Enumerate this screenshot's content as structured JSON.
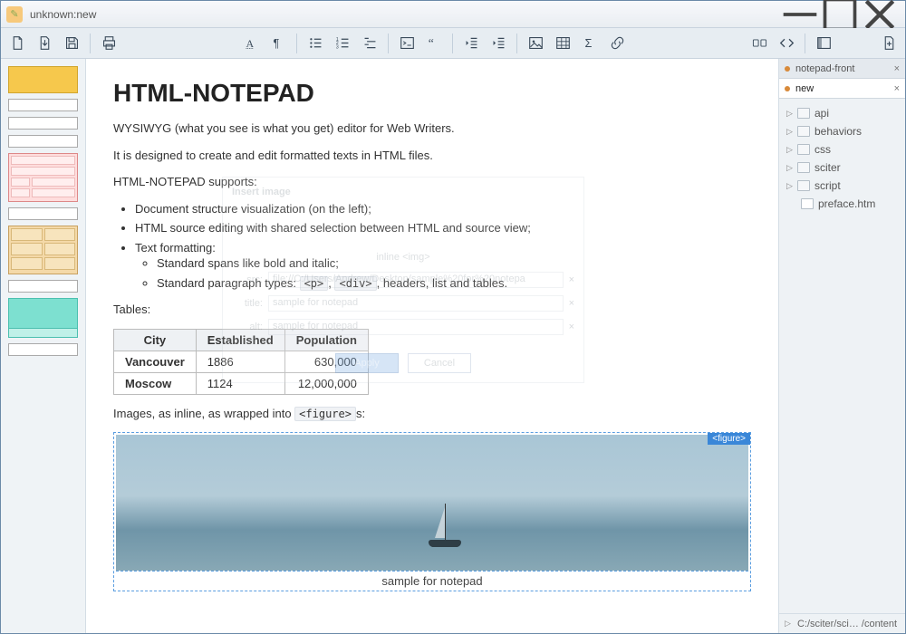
{
  "window": {
    "title": "unknown:new"
  },
  "toolbar": {
    "new": "New",
    "open": "Open",
    "save": "Save",
    "print": "Print",
    "font": "Font",
    "para": "Paragraph",
    "ul": "Unordered list",
    "ol": "Ordered list",
    "dl": "Definition list",
    "pre": "Preformatted",
    "quote": "Blockquote",
    "outdent": "Outdent",
    "indent": "Indent",
    "image": "Image",
    "table": "Table",
    "formula": "Formula",
    "link": "Link",
    "preview": "Preview",
    "source": "Source",
    "sidebar": "Toggle sidebar",
    "addfile": "Add file"
  },
  "doc": {
    "h1": "HTML-NOTEPAD",
    "p1": "WYSIWYG (what you see is what you get) editor for Web Writers.",
    "p2": "It is designed to create and edit formatted texts in HTML files.",
    "p3": "HTML-NOTEPAD supports:",
    "li1": "Document structure visualization (on the left);",
    "li2": "HTML source editing with shared selection between HTML and source view;",
    "li3": "Text formatting:",
    "li3a_pre": "Standard spans like bold and italic;",
    "li3b_pre": "Standard paragraph types: ",
    "li3b_c1": "<p>",
    "li3b_mid": ", ",
    "li3b_c2": "<div>",
    "li3b_post": ", headers, list and tables.",
    "p4": "Tables:",
    "p5_pre": "Images, as inline, as wrapped into ",
    "p5_code": "<figure>",
    "p5_post": "s:",
    "fig_badge": "<figure>",
    "fig_caption": "sample for notepad"
  },
  "table": {
    "headers": [
      "City",
      "Established",
      "Population"
    ],
    "rows": [
      [
        "Vancouver",
        "1886",
        "630,000"
      ],
      [
        "Moscow",
        "1124",
        "12,000,000"
      ]
    ]
  },
  "tabs": [
    {
      "label": "notepad-front",
      "active": false
    },
    {
      "label": "new",
      "active": true
    }
  ],
  "tree": {
    "folders": [
      "api",
      "behaviors",
      "css",
      "sciter",
      "script"
    ],
    "files": [
      "preface.htm"
    ]
  },
  "status": {
    "path": "C:/sciter/sci… /content"
  },
  "dialog": {
    "title": "Insert image",
    "hint": "inline <img>",
    "src_label": "src:",
    "src_value": "file://C:/Users/Andrew/Desktop/sample%20for%20notepa",
    "title_label": "title:",
    "title_value": "sample for notepad",
    "alt_label": "alt:",
    "alt_value": "sample for notepad",
    "apply": "Apply",
    "cancel": "Cancel"
  }
}
